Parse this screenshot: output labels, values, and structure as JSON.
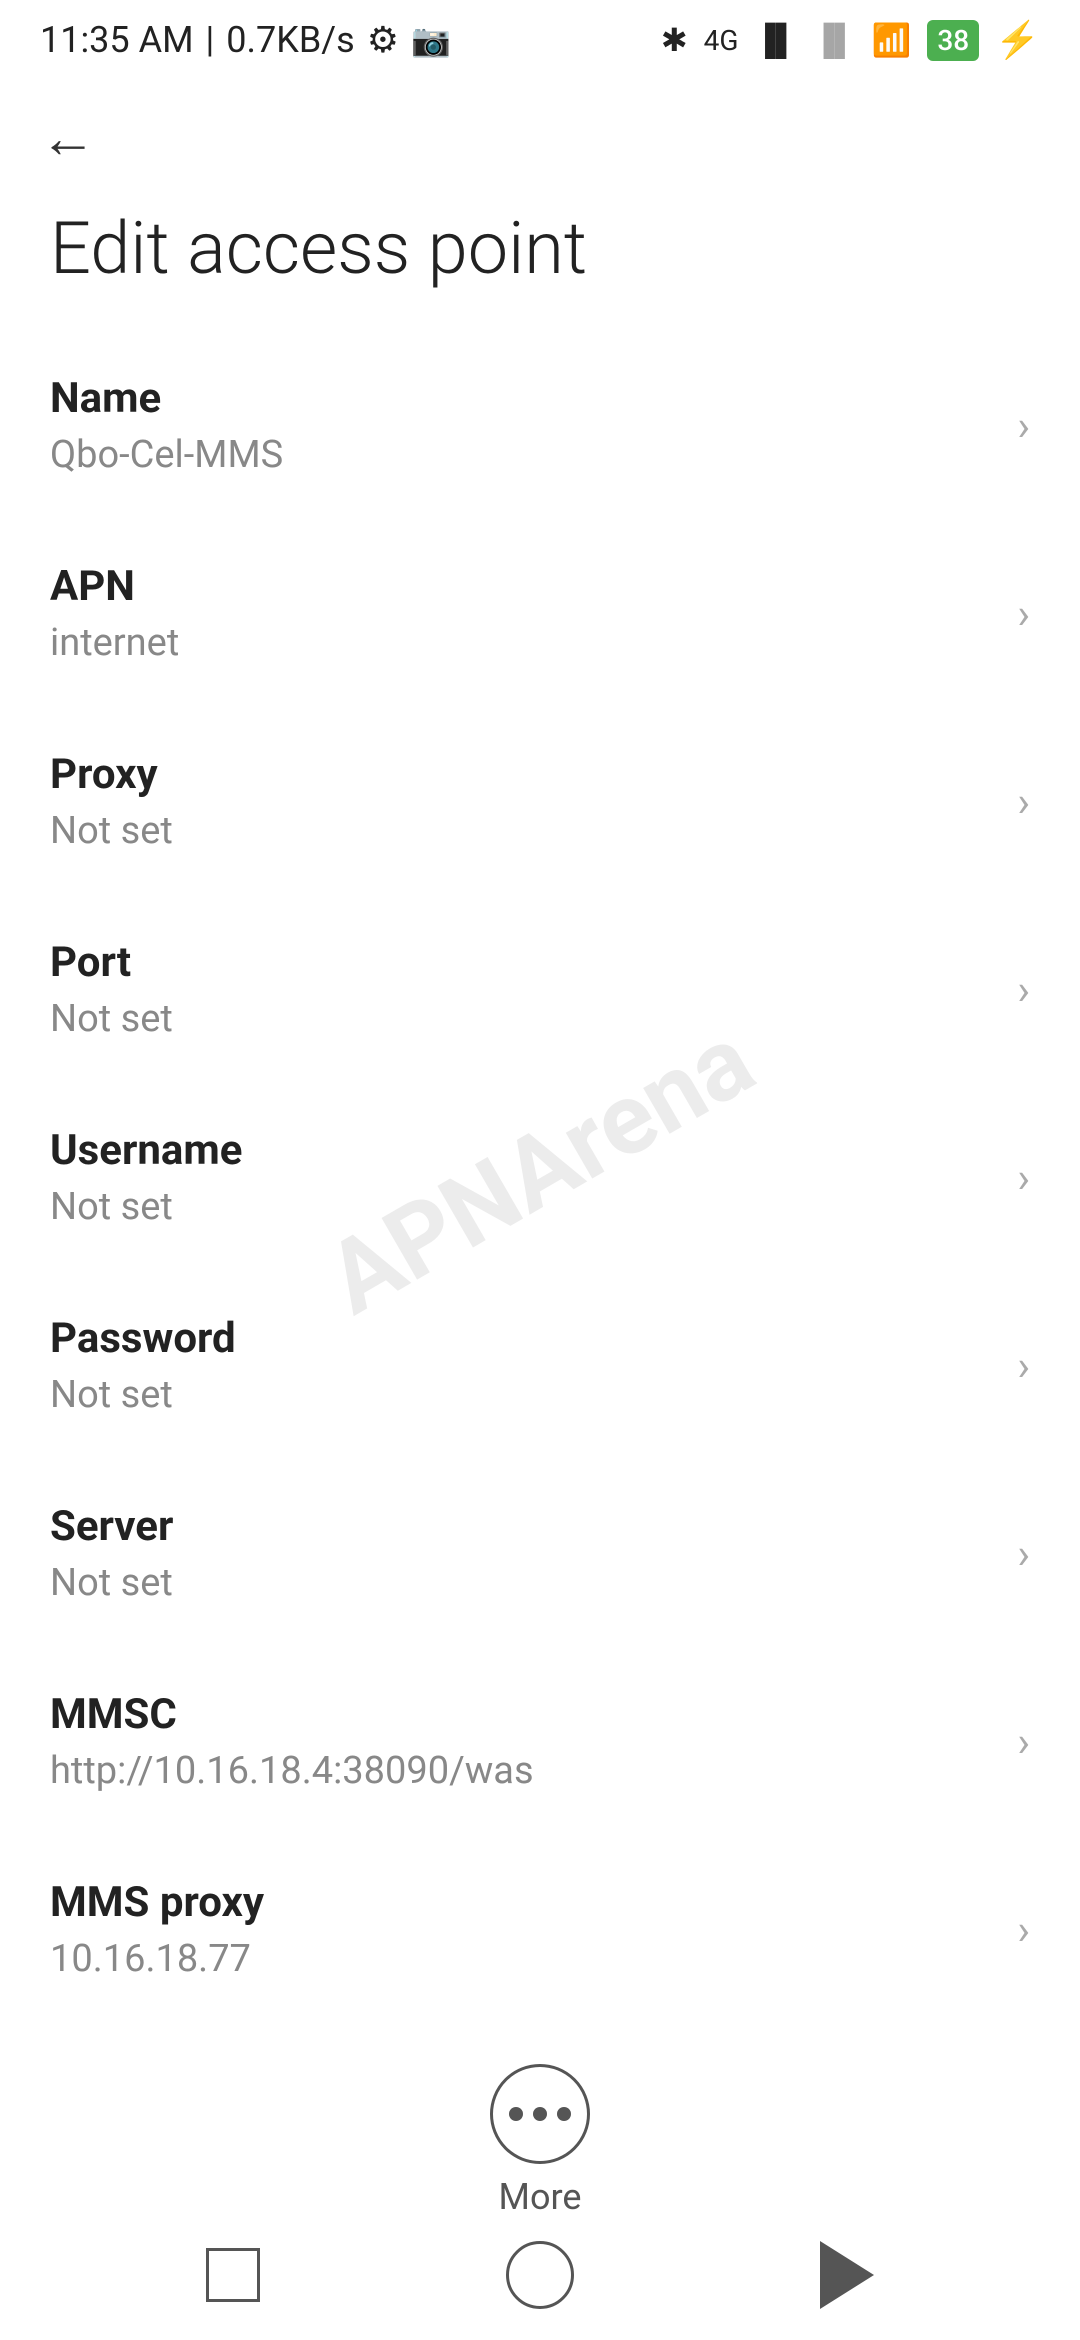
{
  "statusBar": {
    "time": "11:35 AM",
    "networkSpeed": "0.7KB/s"
  },
  "page": {
    "title": "Edit access point",
    "backLabel": "Back"
  },
  "settings": [
    {
      "id": "name",
      "label": "Name",
      "value": "Qbo-Cel-MMS"
    },
    {
      "id": "apn",
      "label": "APN",
      "value": "internet"
    },
    {
      "id": "proxy",
      "label": "Proxy",
      "value": "Not set"
    },
    {
      "id": "port",
      "label": "Port",
      "value": "Not set"
    },
    {
      "id": "username",
      "label": "Username",
      "value": "Not set"
    },
    {
      "id": "password",
      "label": "Password",
      "value": "Not set"
    },
    {
      "id": "server",
      "label": "Server",
      "value": "Not set"
    },
    {
      "id": "mmsc",
      "label": "MMSC",
      "value": "http://10.16.18.4:38090/was"
    },
    {
      "id": "mms-proxy",
      "label": "MMS proxy",
      "value": "10.16.18.77"
    }
  ],
  "more": {
    "label": "More"
  },
  "watermark": "APNArena"
}
